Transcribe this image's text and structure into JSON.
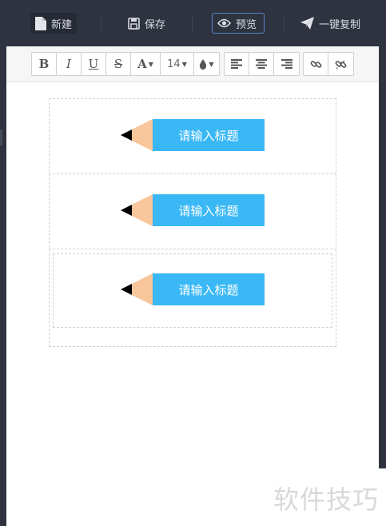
{
  "topbar": {
    "new_label": "新建",
    "save_label": "保存",
    "preview_label": "预览",
    "copy_label": "一键复制"
  },
  "editor_toolbar": {
    "bold": "B",
    "italic": "I",
    "underline": "U",
    "strike": "S",
    "font_color": "A",
    "font_size": "14"
  },
  "blocks": [
    {
      "title_placeholder": "请输入标题"
    },
    {
      "title_placeholder": "请输入标题"
    },
    {
      "title_placeholder": "请输入标题"
    }
  ],
  "watermark": "软件技巧",
  "colors": {
    "topbar_bg": "#2e333f",
    "pencil_body": "#3ab8f5",
    "pencil_wood": "#f8c69a",
    "preview_border": "#5a84c8"
  }
}
